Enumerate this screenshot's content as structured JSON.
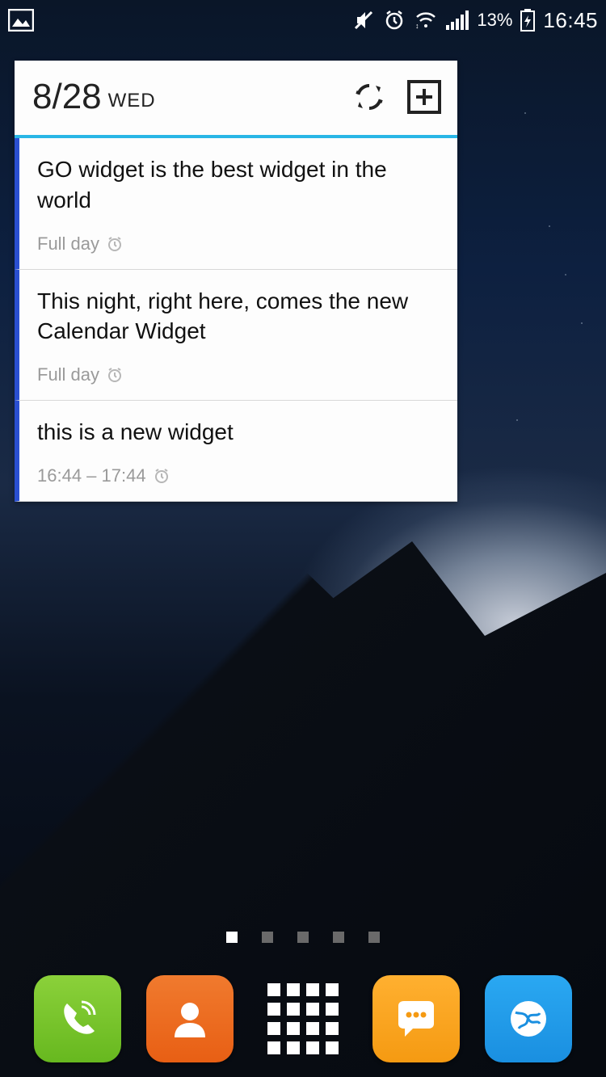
{
  "status": {
    "battery": "13%",
    "time": "16:45"
  },
  "widget": {
    "date": "8/28",
    "day": "WED",
    "events": [
      {
        "title": "GO widget is the best widget in the world",
        "sub": "Full day"
      },
      {
        "title": "This night, right here, comes the new Calendar Widget",
        "sub": "Full day"
      },
      {
        "title": "this is a new widget",
        "sub": "16:44 – 17:44"
      }
    ]
  },
  "pages": {
    "count": 5,
    "active": 0
  }
}
